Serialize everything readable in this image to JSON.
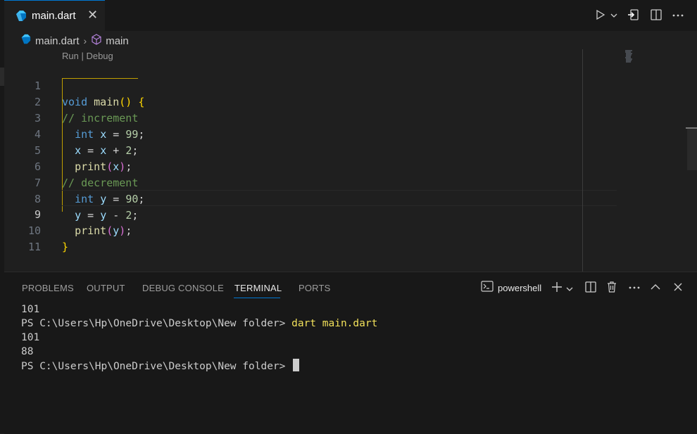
{
  "tab": {
    "label": "main.dart",
    "close": "✕"
  },
  "breadcrumb": {
    "file": "main.dart",
    "symbol": "main"
  },
  "codelens": "Run | Debug",
  "code_lines": [
    {
      "n": "1"
    },
    {
      "n": "2"
    },
    {
      "n": "3"
    },
    {
      "n": "4"
    },
    {
      "n": "5"
    },
    {
      "n": "6"
    },
    {
      "n": "7"
    },
    {
      "n": "8"
    },
    {
      "n": "9"
    },
    {
      "n": "10"
    },
    {
      "n": "11"
    }
  ],
  "code": {
    "l1": {
      "kw": "void",
      "fn": "main",
      "open": "()",
      "brace": "{"
    },
    "l2": "// increment",
    "l3": {
      "kw": "int",
      "var": "x",
      "eq": "=",
      "num": "99",
      "semi": ";"
    },
    "l4": {
      "a": "x",
      "eq": "=",
      "b": "x",
      "plus": "+",
      "num": "2",
      "semi": ";"
    },
    "l5": {
      "fn": "print",
      "po": "(",
      "arg": "x",
      "pc": ")",
      "semi": ";"
    },
    "l6": "// decrement",
    "l7": {
      "kw": "int",
      "var": "y",
      "eq": "=",
      "num": "90",
      "semi": ";"
    },
    "l8": {
      "a": "y",
      "eq": "=",
      "b": "y",
      "minus": "-",
      "num": "2",
      "semi": ";"
    },
    "l9": {
      "fn": "print",
      "po": "(",
      "arg": "y",
      "pc": ")",
      "semi": ";"
    },
    "l10": "}"
  },
  "panel": {
    "tabs": [
      "PROBLEMS",
      "OUTPUT",
      "DEBUG CONSOLE",
      "TERMINAL",
      "PORTS"
    ],
    "active_tab": "TERMINAL",
    "shell": "powershell"
  },
  "terminal": {
    "out1": "101",
    "prompt": "PS C:\\Users\\Hp\\OneDrive\\Desktop\\New folder> ",
    "command": "dart main.dart",
    "out2": "101",
    "out3": "88"
  },
  "colors": {
    "accent": "#0078d4",
    "dart_blue": "#41c4ff",
    "dart_dark": "#0175c2"
  },
  "icons": [
    "dart-icon",
    "close-icon",
    "run-icon",
    "chevron-down-icon",
    "open-changes-icon",
    "split-editor-icon",
    "more-actions-icon",
    "cube-icon",
    "terminal-icon",
    "plus-icon",
    "trash-icon",
    "chevron-up-icon"
  ]
}
